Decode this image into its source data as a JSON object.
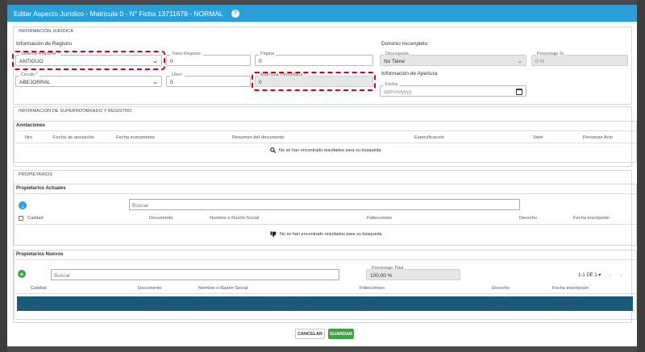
{
  "modal": {
    "title": "Editar Aspecto Jurídico - Matricula 0 - N° Ficha 13711678 - NORMAL"
  },
  "info_juridica": {
    "section_title": "INFORMACIÓN JURÍDICA",
    "registro_title": "Información de Registro",
    "sistema_registral": {
      "label": "Sistema Registral *",
      "value": "ANTIGUO"
    },
    "tomo_registro": {
      "label": "Tomo Registro:",
      "value": "0"
    },
    "pagina": {
      "label": "Página",
      "value": "0"
    },
    "circulo": {
      "label": "Circulo *",
      "value": "ABEJORRAL"
    },
    "libro": {
      "label": "Libro:",
      "value": "0"
    },
    "matricula": {
      "label": "Matrícula Inmobiliaria *",
      "value": "0"
    },
    "dominio_title": "Dominio Incompleto",
    "descripcion": {
      "label": "Descripción",
      "value": "No Tiene"
    },
    "porcentaje": {
      "label": "Porcentaje %",
      "value": "0 %"
    },
    "apertura_title": "Información de Apertura",
    "fecha": {
      "label": "Fecha",
      "placeholder": "dd/mm/yyyy"
    }
  },
  "supernotariado": {
    "section_title": "INFORMACIÓN DE SUPERNOTARIADO Y REGISTRO",
    "anotaciones_title": "Anotaciones",
    "columns": [
      "Nro",
      "Fecha de anotación",
      "Fecha instrumento",
      "Resumen del documento",
      "Especificación",
      "Valor",
      "Personas Acto"
    ],
    "empty_text": "No se han encontrado resultados para su búsqueda"
  },
  "propietarios": {
    "section_title": "PROPIETARIOS",
    "actuales": {
      "title": "Propietarios Actuales",
      "search_placeholder": "Buscar",
      "columns": [
        "Calidad",
        "Documento",
        "Nombre o Razón Social",
        "Fideicomiso",
        "Derecho",
        "Fecha inscripción"
      ],
      "empty_text": "No se han encontrado resultados para su búsqueda"
    },
    "nuevos": {
      "title": "Propietarios Nuevos",
      "search_placeholder": "Buscar",
      "porcentaje_total": {
        "label": "Porcentaje Total",
        "value": "100,00 %"
      },
      "pagination": "1-1 DE 1",
      "columns": [
        "Calidad",
        "Documento",
        "Nombre o Razón Social",
        "Fideicomiso",
        "Derecho",
        "Fecha inscripción"
      ],
      "rows": [
        {
          "calidad": "Dueño",
          "documento": "890900608",
          "nombre": "CONSTRUCCIONES E INMUEBLES DEL NORTE S.A.S.",
          "fideicomiso": "NO",
          "derecho": "100.00",
          "fecha": "01/01/2020"
        }
      ]
    }
  },
  "footer": {
    "cancel_label": "CANCELAR",
    "save_label": "GUARDAR"
  },
  "colors": {
    "header": "#2a9fd8",
    "highlight": "#d0021b",
    "add_green": "#43a047",
    "save_green": "#43a047",
    "selected_row": "#1b5a78"
  },
  "icons": {
    "help": "help-icon",
    "dropdown": "chevron-down-icon",
    "calendar": "calendar-icon",
    "search": "search-icon",
    "thumbs_down": "thumbs-down-icon",
    "download": "download-icon",
    "add": "add-icon"
  }
}
